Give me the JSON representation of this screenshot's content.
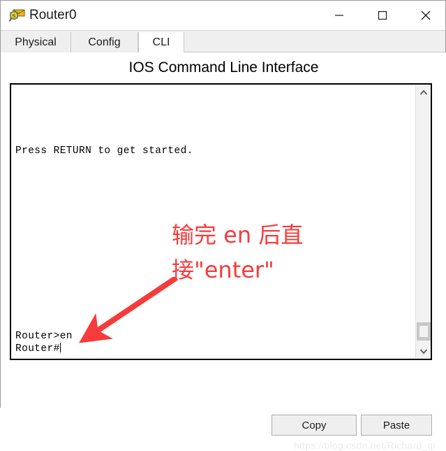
{
  "window": {
    "title": "Router0",
    "icon": "packet-tracer-router-icon",
    "controls": {
      "minimize": "—",
      "maximize": "□",
      "close": "✕"
    }
  },
  "tabs": [
    {
      "label": "Physical",
      "active": false
    },
    {
      "label": "Config",
      "active": false
    },
    {
      "label": "CLI",
      "active": true
    }
  ],
  "main": {
    "heading": "IOS Command Line Interface",
    "console": {
      "top_text": "Press RETURN to get started.",
      "bottom_line_1": "Router>en",
      "bottom_line_2": "Router#"
    },
    "scrollbar": {
      "up_arrow": "⌃",
      "down_arrow": "⌄"
    }
  },
  "annotation": {
    "text": "输完 en 后直\n接\"enter\"",
    "color": "#f73b3b"
  },
  "buttons": {
    "copy": "Copy",
    "paste": "Paste"
  },
  "watermark": "https://blog.csdn.net/Richard_qi"
}
